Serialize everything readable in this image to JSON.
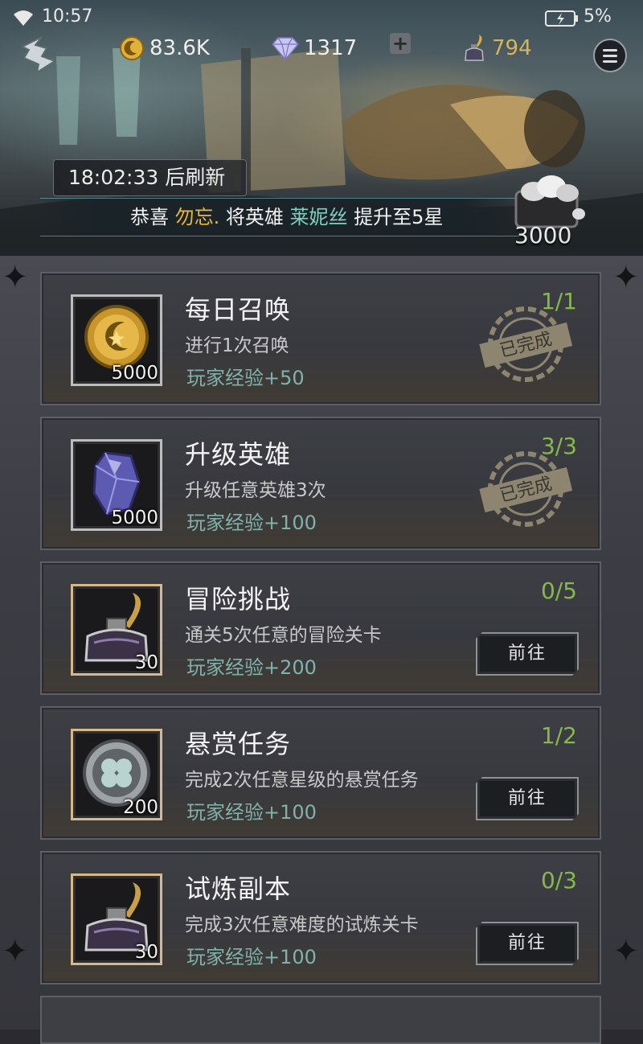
{
  "status_bar": {
    "time": "10:57",
    "battery": "5%"
  },
  "currencies": {
    "gold": "83.6K",
    "gems": "1317",
    "ink": "794"
  },
  "header": {
    "refresh_text": "18:02:33 后刷新",
    "ticker": {
      "prefix": "恭喜 ",
      "player": "勿忘.",
      "middle": " 将英雄 ",
      "hero": "莱妮丝",
      "suffix": " 提升至5星"
    },
    "chest_value": "3000"
  },
  "tasks": [
    {
      "title": "每日召唤",
      "desc": "进行1次召唤",
      "exp": "玩家经验+50",
      "progress": "1/1",
      "reward_qty": "5000",
      "icon": "gold-coin-icon",
      "status": "completed",
      "stamp": "已完成"
    },
    {
      "title": "升级英雄",
      "desc": "升级任意英雄3次",
      "exp": "玩家经验+100",
      "progress": "3/3",
      "reward_qty": "5000",
      "icon": "crystal-icon",
      "status": "completed",
      "stamp": "已完成"
    },
    {
      "title": "冒险挑战",
      "desc": "通关5次任意的冒险关卡",
      "exp": "玩家经验+200",
      "progress": "0/5",
      "reward_qty": "30",
      "icon": "ink-bottle-icon",
      "status": "open",
      "button": "前往"
    },
    {
      "title": "悬赏任务",
      "desc": "完成2次任意星级的悬赏任务",
      "exp": "玩家经验+100",
      "progress": "1/2",
      "reward_qty": "200",
      "icon": "clover-medal-icon",
      "status": "open",
      "button": "前往"
    },
    {
      "title": "试炼副本",
      "desc": "完成3次任意难度的试炼关卡",
      "exp": "玩家经验+100",
      "progress": "0/3",
      "reward_qty": "30",
      "icon": "ink-bottle-icon",
      "status": "open",
      "button": "前往"
    }
  ],
  "colors": {
    "progress": "#86b84e",
    "exp": "#7fb2ab",
    "ticker_player": "#e7b83f",
    "ticker_hero": "#7fd0c2"
  }
}
